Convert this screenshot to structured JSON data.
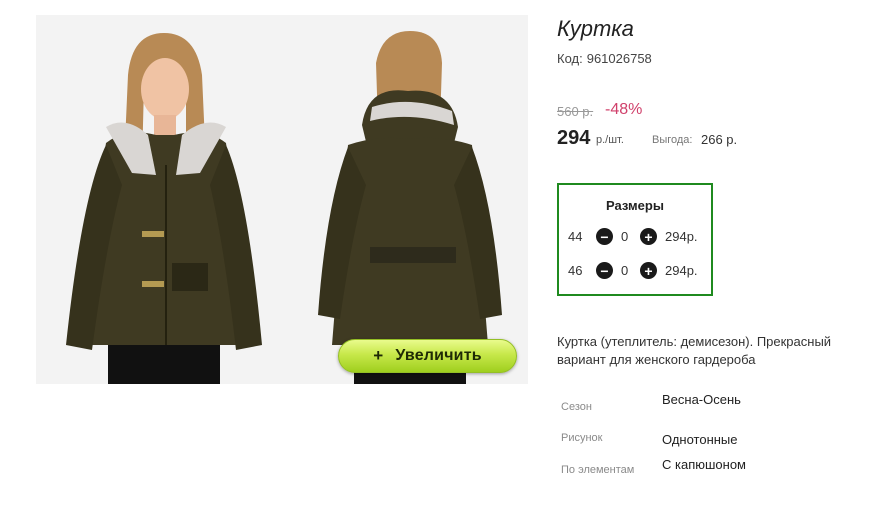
{
  "product": {
    "title": "Куртка",
    "code_label": "Код:",
    "code": "961026758",
    "old_price": "560 р.",
    "discount": "-48%",
    "price": "294",
    "price_unit": "р./шт.",
    "benefit_label": "Выгода:",
    "benefit_value": "266 р.",
    "zoom_button": {
      "plus": "+",
      "label": "Увеличить"
    }
  },
  "sizes": {
    "title": "Размеры",
    "items": [
      {
        "size": "44",
        "minus": "−",
        "qty": "0",
        "plus": "+",
        "price": "294р."
      },
      {
        "size": "46",
        "minus": "−",
        "qty": "0",
        "plus": "+",
        "price": "294р."
      }
    ]
  },
  "description": "Куртка (утеплитель: демисезон). Прекрасный вариант для женского гардероба",
  "attributes": [
    {
      "label": "Сезон",
      "value": "Весна-Осень"
    },
    {
      "label": "Рисунок",
      "value": "Однотонные"
    },
    {
      "label": "По элементам",
      "value": "С капюшоном"
    }
  ],
  "colors": {
    "discount": "#d0406b",
    "sizes_border": "#1f8a1f",
    "zoom_button": "#b8e03a",
    "jacket": "#3f3a22"
  },
  "icons": {
    "zoom": "plus-icon",
    "decrease": "minus-circle-icon",
    "increase": "plus-circle-icon"
  }
}
